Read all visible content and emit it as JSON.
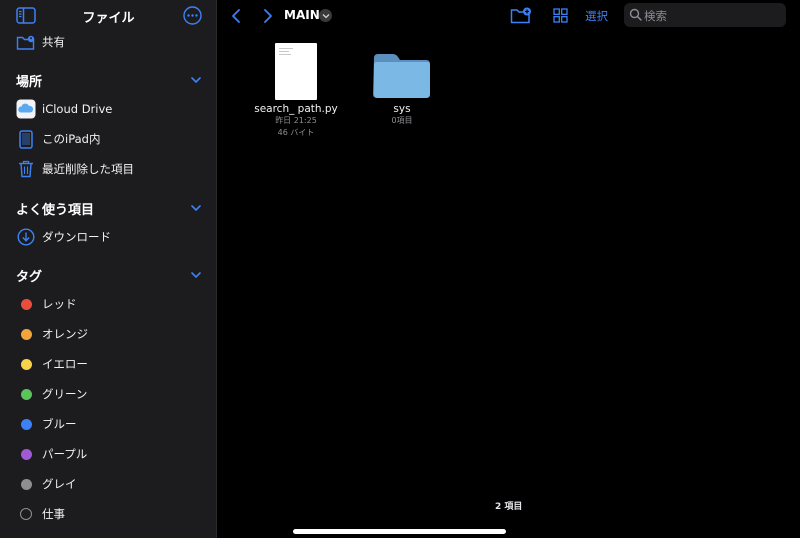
{
  "sidebar": {
    "title": "ファイル",
    "shared": {
      "label": "共有",
      "icon": "shared-folder-icon"
    },
    "locations": {
      "title": "場所",
      "items": [
        {
          "label": "iCloud Drive",
          "icon": "icloud-drive-icon"
        },
        {
          "label": "このiPad内",
          "icon": "ipad-icon"
        },
        {
          "label": "最近削除した項目",
          "icon": "trash-icon"
        }
      ]
    },
    "favorites": {
      "title": "よく使う項目",
      "items": [
        {
          "label": "ダウンロード",
          "icon": "download-icon"
        }
      ]
    },
    "tags": {
      "title": "タグ",
      "items": [
        {
          "label": "レッド",
          "color": "#eb4d3d"
        },
        {
          "label": "オレンジ",
          "color": "#f5a33b"
        },
        {
          "label": "イエロー",
          "color": "#f7d34a"
        },
        {
          "label": "グリーン",
          "color": "#5ac35a"
        },
        {
          "label": "ブルー",
          "color": "#3c82f6"
        },
        {
          "label": "パープル",
          "color": "#a05ad6"
        },
        {
          "label": "グレイ",
          "color": "#8e8e93"
        },
        {
          "label": "仕事",
          "color": ""
        }
      ]
    }
  },
  "toolbar": {
    "breadcrumb": "MAIN",
    "select_label": "選択",
    "search_placeholder": "検索"
  },
  "files": [
    {
      "name": "search_ path.py",
      "date": "昨日 21:25",
      "size": "46 バイト",
      "icon": "python-file-icon"
    },
    {
      "name": "sys",
      "items": "0項目",
      "icon": "folder-icon"
    }
  ],
  "status": {
    "item_count": "2 項目"
  },
  "colors": {
    "accent": "#3c82f6",
    "sidebar_bg": "#1c1c1e",
    "folder": "#7cb8e6"
  }
}
